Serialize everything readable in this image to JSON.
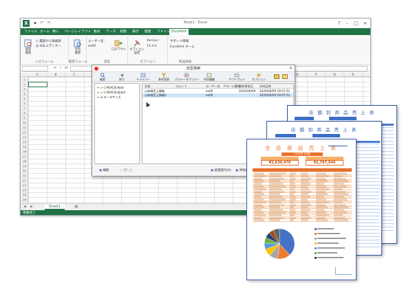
{
  "excel": {
    "window_title": "Book1 - Excel",
    "quick_access": [
      "save-icon",
      "undo-icon",
      "redo-icon"
    ],
    "tabs": [
      "ファイル",
      "ホーム",
      "挿入",
      "ページレイアウト",
      "数式",
      "データ",
      "校閲",
      "表示",
      "開発",
      "アドイン",
      "Excellent"
    ],
    "active_tab": "Excellent",
    "ribbon": {
      "groups": [
        {
          "label": "入力フォーム",
          "buttons": [
            "固定\n検索"
          ],
          "small_items": [
            "履歴から再検索",
            "SQLエディター"
          ]
        },
        {
          "label": "帳票フォーム",
          "buttons": [
            "定型\n検索"
          ]
        },
        {
          "label": "認証",
          "user_label": "ユーザー名 :",
          "user_value": "ex00",
          "buttons": [
            "ログアウト"
          ]
        },
        {
          "label": "オプション",
          "buttons": [
            "オプション\n設定"
          ],
          "version_label": "Version :",
          "version_value": "11.3.0"
        },
        {
          "label": "製品情報",
          "small_items": [
            "サポート情報",
            "Excellent ホーム"
          ]
        }
      ]
    },
    "formula_bar": {
      "fx": "fx"
    },
    "columns": [
      "A",
      "B",
      "C",
      "D",
      "E",
      "F",
      "G",
      "H",
      "I",
      "J",
      "K",
      "L",
      "M",
      "N",
      "O",
      "P",
      "Q",
      "R"
    ],
    "rows": [
      "1",
      "2",
      "3",
      "4",
      "5",
      "6",
      "7",
      "8",
      "9",
      "10",
      "11",
      "12",
      "13",
      "14",
      "15",
      "16",
      "17",
      "18",
      "19",
      "20",
      "21",
      "22",
      "23",
      "24",
      "25",
      "26"
    ],
    "sheet_tab": "Sheet1",
    "status": "準備完了"
  },
  "dialog": {
    "title": "定型検索",
    "toolbar": [
      "検索",
      "戻り",
      "ドライバー",
      "条件変更",
      "パラメータクリアー",
      "SQL編集",
      "アウトプット",
      "オプション"
    ],
    "tree": [
      {
        "label": "C:¥EXCEL¥Job",
        "expand": "+"
      },
      {
        "label": "C:¥EXCEL¥Job2",
        "expand": "+"
      },
      {
        "label": "データサイズ",
        "expand": "+"
      }
    ],
    "list_headers": [
      "名前",
      "コメント",
      "ユーザー名",
      "アラーム属性",
      "最終更新日",
      "作成日時"
    ],
    "list_rows": [
      {
        "name": "有線売上情報",
        "comment": "",
        "user": "ex00",
        "alarm": "",
        "updated": "2020/06/09",
        "created": "2020/06/09 19:07:51"
      },
      {
        "name": "有線売上情報2",
        "comment": "",
        "user": "ex00",
        "alarm": "",
        "updated": "",
        "created": "2020/06/09 19:07:51"
      }
    ],
    "bottom": {
      "search": "検索",
      "close": "閉じる",
      "exec_history": "処理実行(H)",
      "result": "共有検索(F)"
    }
  },
  "reports": {
    "back_title": "店 舗 別 商 品 売 上 表",
    "middle_title": "店 舗 別 商 品 売 上 表",
    "front": {
      "title": "全 店 商 品 売 上 表",
      "period": "2018年 4月度",
      "kpi_headers": [
        "",
        ""
      ],
      "kpi_values": [
        "¥2,639,470",
        "¥2,767,544"
      ]
    },
    "pie_colors": [
      "#4472c4",
      "#ed7d31",
      "#a5a5a5",
      "#ffc000",
      "#5b9bd5",
      "#70ad47",
      "#264478",
      "#9e480e",
      "#636363"
    ],
    "pie_values": [
      38,
      14,
      9,
      8,
      7,
      6,
      6,
      5,
      7
    ],
    "legend": [
      "",
      "",
      "",
      "",
      "",
      "",
      ""
    ]
  },
  "colors": {
    "excel_green": "#217346",
    "report_orange": "#e8702a",
    "report_blue": "#2b5fb0"
  }
}
